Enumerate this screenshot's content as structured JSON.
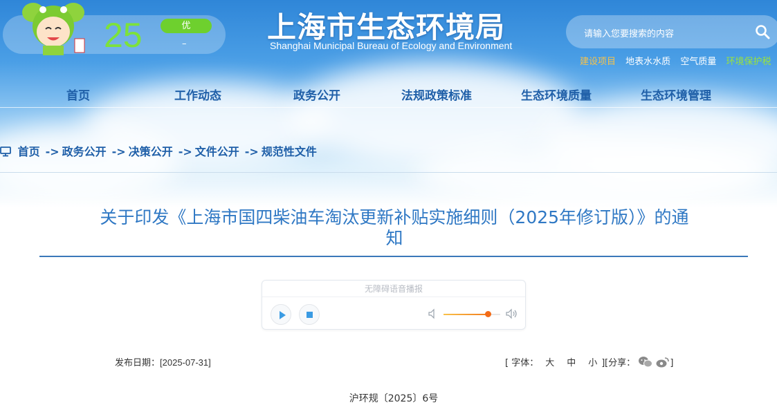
{
  "aqi": {
    "value": "25",
    "level": "优",
    "sub": "–"
  },
  "logo": {
    "cn": "上海市生态环境局",
    "en": "Shanghai Municipal Bureau of Ecology and Environment"
  },
  "search": {
    "placeholder": "请输入您要搜索的内容"
  },
  "quick_links": [
    {
      "label": "建设项目",
      "color": "#f7c24a"
    },
    {
      "label": "地表水水质",
      "color": "#ffffff"
    },
    {
      "label": "空气质量",
      "color": "#ffffff"
    },
    {
      "label": "环境保护税",
      "color": "#9be33a"
    }
  ],
  "nav": [
    "首页",
    "工作动态",
    "政务公开",
    "法规政策标准",
    "生态环境质量",
    "生态环境管理"
  ],
  "breadcrumb": {
    "items": [
      "首页",
      "政务公开",
      "决策公开",
      "文件公开",
      "规范性文件"
    ],
    "separator": "->"
  },
  "article": {
    "title_line1": "关于印发《上海市国四柴油车淘汰更新补贴实施细则（2025年修订版）》的通",
    "title_line2": "知"
  },
  "player": {
    "header": "无障碍语音播报",
    "volume": 0.78
  },
  "meta": {
    "date_label": "发布日期：",
    "date_value": "[2025-07-31]",
    "font_open": "[ 字体：",
    "font_large": "大",
    "font_medium": "中",
    "font_small": "小",
    "font_close": "]",
    "share_label": "[分享：",
    "share_close": "]"
  },
  "doc_number": "沪环规〔2025〕6号",
  "colors": {
    "nav_text": "#1f5fa8",
    "title": "#2f78c4",
    "aqi_green": "#7de23a"
  }
}
